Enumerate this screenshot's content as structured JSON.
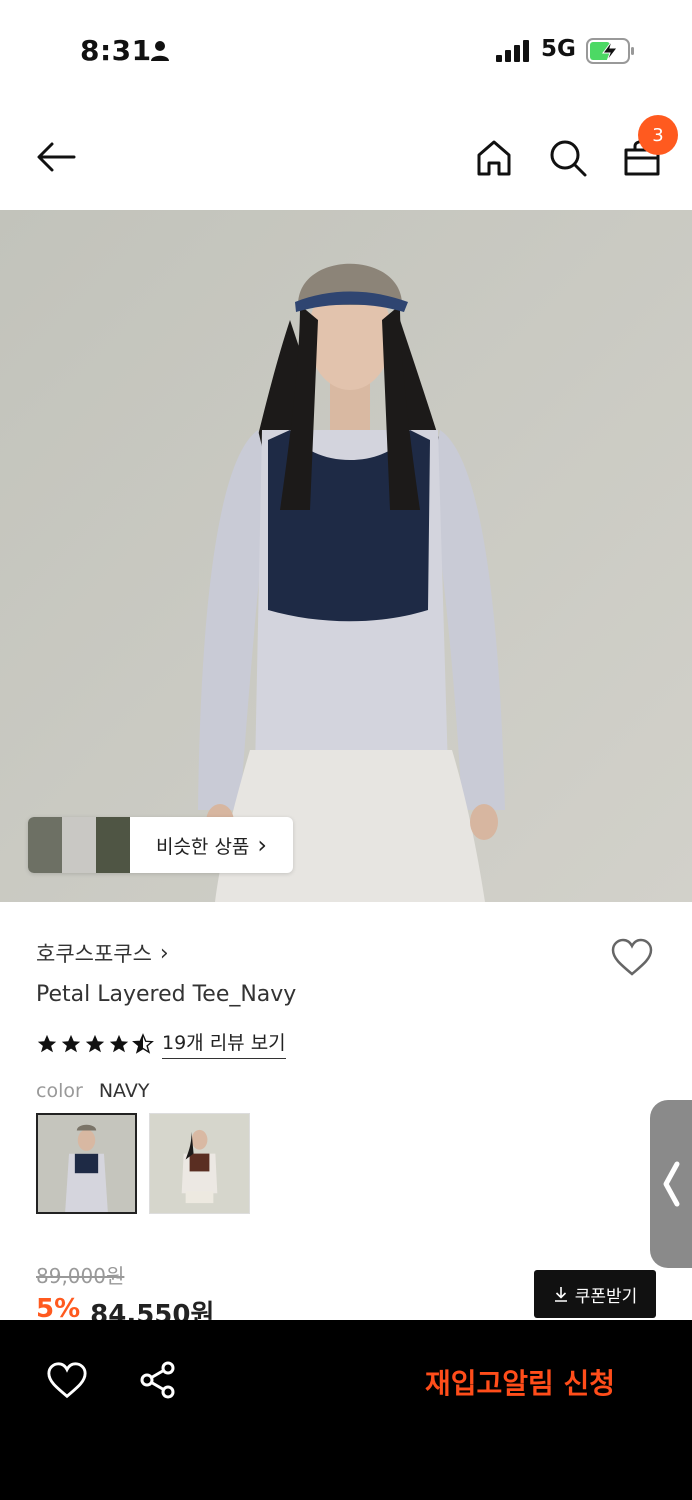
{
  "status_bar": {
    "time": "8:31",
    "network": "5G"
  },
  "nav": {
    "cart_count": "3"
  },
  "hero": {
    "similar_label": "비슷한 상품",
    "similar_chevron": "›"
  },
  "product": {
    "brand": "호쿠스포쿠스",
    "brand_chevron": "›",
    "name": "Petal Layered Tee_Navy",
    "rating": 4.5,
    "review_link": "19개 리뷰 보기",
    "color_key": "color",
    "color_value": "NAVY",
    "original_price": "89,000원",
    "discount": "5%",
    "sale_price": "84,550원",
    "coupon_label": "쿠폰받기"
  },
  "bottom_bar": {
    "restock_label": "재입고알림 신청"
  },
  "colors": {
    "accent": "#ff5a1f",
    "bottom_bar": "#000000",
    "restock_text": "#ff4d1a"
  }
}
